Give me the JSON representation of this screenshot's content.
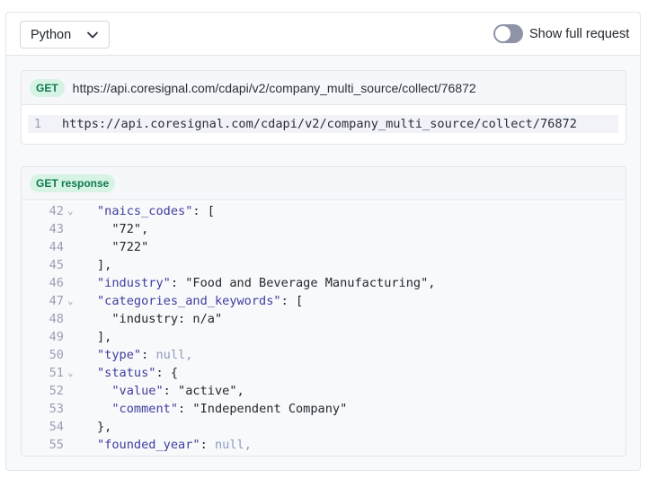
{
  "toolbar": {
    "language": "Python",
    "toggle_label": "Show full request",
    "toggle_on": false
  },
  "request": {
    "method": "GET",
    "url": "https://api.coresignal.com/cdapi/v2/company_multi_source/collect/76872",
    "code_line_number": "1",
    "code_text": "https://api.coresignal.com/cdapi/v2/company_multi_source/collect/76872"
  },
  "response": {
    "badge": "GET response",
    "lines": [
      {
        "num": "42",
        "fold": "⌄",
        "indent": "",
        "key": "\"naics_codes\"",
        "sep": ": ",
        "val": "[",
        "vtype": "p"
      },
      {
        "num": "43",
        "fold": "",
        "indent": "  ",
        "key": "",
        "sep": "",
        "val": "\"72\",",
        "vtype": "s"
      },
      {
        "num": "44",
        "fold": "",
        "indent": "  ",
        "key": "",
        "sep": "",
        "val": "\"722\"",
        "vtype": "s"
      },
      {
        "num": "45",
        "fold": "",
        "indent": "",
        "key": "",
        "sep": "",
        "val": "],",
        "vtype": "p"
      },
      {
        "num": "46",
        "fold": "",
        "indent": "",
        "key": "\"industry\"",
        "sep": ": ",
        "val": "\"Food and Beverage Manufacturing\",",
        "vtype": "s"
      },
      {
        "num": "47",
        "fold": "⌄",
        "indent": "",
        "key": "\"categories_and_keywords\"",
        "sep": ": ",
        "val": "[",
        "vtype": "p"
      },
      {
        "num": "48",
        "fold": "",
        "indent": "  ",
        "key": "",
        "sep": "",
        "val": "\"industry: n/a\"",
        "vtype": "s"
      },
      {
        "num": "49",
        "fold": "",
        "indent": "",
        "key": "",
        "sep": "",
        "val": "],",
        "vtype": "p"
      },
      {
        "num": "50",
        "fold": "",
        "indent": "",
        "key": "\"type\"",
        "sep": ": ",
        "val": "null,",
        "vtype": "n"
      },
      {
        "num": "51",
        "fold": "⌄",
        "indent": "",
        "key": "\"status\"",
        "sep": ": ",
        "val": "{",
        "vtype": "p"
      },
      {
        "num": "52",
        "fold": "",
        "indent": "  ",
        "key": "\"value\"",
        "sep": ": ",
        "val": "\"active\",",
        "vtype": "s"
      },
      {
        "num": "53",
        "fold": "",
        "indent": "  ",
        "key": "\"comment\"",
        "sep": ": ",
        "val": "\"Independent Company\"",
        "vtype": "s"
      },
      {
        "num": "54",
        "fold": "",
        "indent": "",
        "key": "",
        "sep": "",
        "val": "},",
        "vtype": "p"
      },
      {
        "num": "55",
        "fold": "",
        "indent": "",
        "key": "\"founded_year\"",
        "sep": ": ",
        "val": "null,",
        "vtype": "n"
      }
    ]
  },
  "colors": {
    "key": "#3f3d9e",
    "null": "#8f9abf",
    "badge_bg": "#d7f3e6",
    "badge_text": "#0f7a4c",
    "toggle_off": "#8e93a8"
  }
}
